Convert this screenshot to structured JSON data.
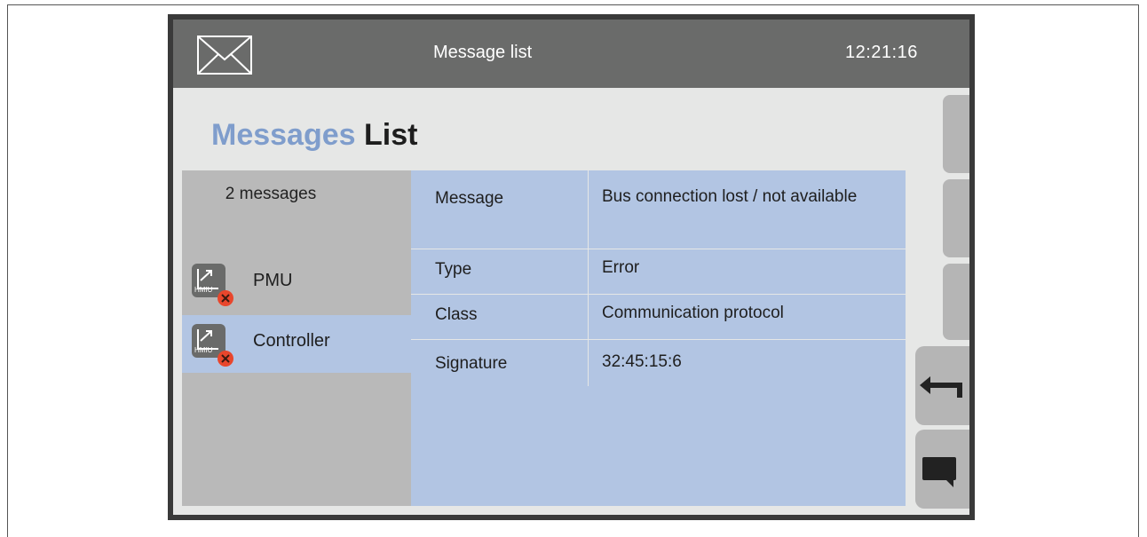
{
  "header": {
    "icon": "mail-icon",
    "title": "Message list",
    "time": "12:21:16"
  },
  "page": {
    "heading_accent": "Messages",
    "heading_main": "List"
  },
  "messages": {
    "count_label": "2 messages",
    "items": [
      {
        "label": "PMU",
        "icon": "hmiu-error-icon",
        "icon_text": "HMIU",
        "selected": false
      },
      {
        "label": "Controller",
        "icon": "hmiu-error-icon",
        "icon_text": "HMIU",
        "selected": true
      }
    ]
  },
  "details": [
    {
      "key": "Message",
      "value": "Bus connection lost / not available"
    },
    {
      "key": "Type",
      "value": "Error"
    },
    {
      "key": "Class",
      "value": "Communication protocol"
    },
    {
      "key": "Signature",
      "value": "32:45:15:6"
    }
  ],
  "side_buttons": [
    {
      "icon": "back-arrow-icon"
    },
    {
      "icon": "message-bubble-icon"
    }
  ],
  "colors": {
    "accent": "#7f9dcc",
    "selected_row": "#b2c5e3",
    "error": "#e8462c",
    "header_bg": "#6a6b6a"
  }
}
